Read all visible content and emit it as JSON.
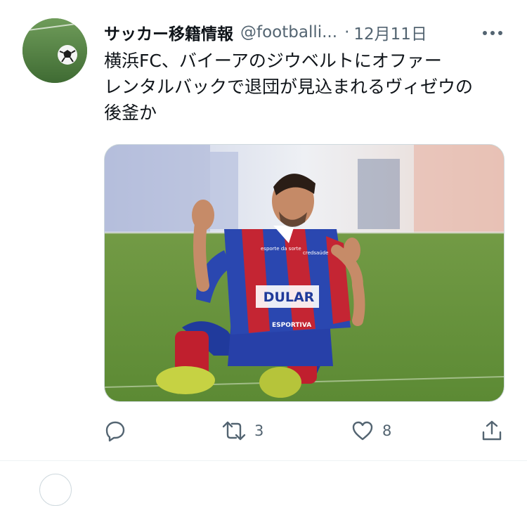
{
  "tweet": {
    "author_name": "サッカー移籍情報",
    "author_handle": "@footballi...",
    "separator": "·",
    "timestamp": "12月11日",
    "text": "横浜FC、バイーアのジウベルトにオファー\nレンタルバックで退団が見込まれるヴィゼウの\n後釜か",
    "media_image": {
      "jersey_sponsor": "DULAR",
      "jersey_sub_sponsor": "ESPORTIVA",
      "sleeve_brand": "esporte da sorte",
      "chest_brand": "credsaúde"
    },
    "actions": {
      "reply": {
        "icon": "reply-icon",
        "count": ""
      },
      "retweet": {
        "icon": "retweet-icon",
        "count": "3"
      },
      "like": {
        "icon": "heart-icon",
        "count": "8"
      },
      "share": {
        "icon": "share-icon",
        "count": ""
      }
    }
  },
  "colors": {
    "text_primary": "#0f1419",
    "text_secondary": "#536471",
    "border": "#cfd9de"
  }
}
